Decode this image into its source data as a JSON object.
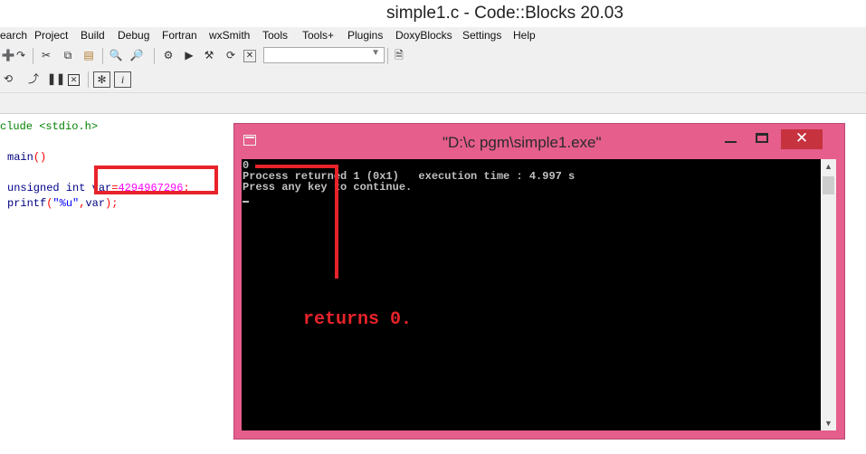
{
  "window": {
    "title": "simple1.c - Code::Blocks 20.03"
  },
  "menu": [
    "earch",
    "Project",
    "Build",
    "Debug",
    "Fortran",
    "wxSmith",
    "Tools",
    "Tools+",
    "Plugins",
    "DoxyBlocks",
    "Settings",
    "Help"
  ],
  "toolbar1_icons": [
    "new-file-icon",
    "redo-icon",
    "cut-icon",
    "copy-icon",
    "paste-icon",
    "find-icon",
    "replace-icon",
    "settings-icon",
    "run-icon",
    "build-run-icon",
    "rebuild-icon",
    "abort-icon",
    "target-dropdown",
    "doc-icon"
  ],
  "toolbar2_icons": [
    "step-into-icon",
    "step-out-icon",
    "pause-icon",
    "stop-icon",
    "debug-windows-icon",
    "info-icon"
  ],
  "code": {
    "line1_pp": "clude <stdio.h>",
    "line2_fn": "main",
    "line2_parens": "()",
    "line3_kw1": "unsigned",
    "line3_kw2": "int",
    "line3_var": "var",
    "line3_eq": "=",
    "line3_num": "4294967296",
    "line3_semi": ";",
    "line4_fn": "printf",
    "line4_open": "(",
    "line4_str": "\"%u\"",
    "line4_comma": ",",
    "line4_var": "var",
    "line4_close": ");"
  },
  "console": {
    "title": "\"D:\\c pgm\\simple1.exe\"",
    "close_glyph": "✕",
    "lines": [
      "0",
      "Process returned 1 (0x1)   execution time : 4.997 s",
      "Press any key to continue."
    ]
  },
  "annotation": {
    "text": "returns 0.",
    "color": "#e8232a"
  },
  "colors": {
    "console_frame": "#e55e8c",
    "close_button": "#c7323f",
    "highlight": "#e8232a"
  }
}
